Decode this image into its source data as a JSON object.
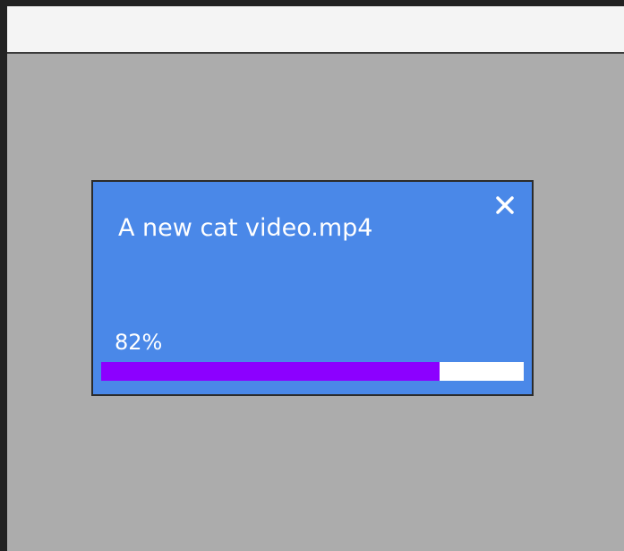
{
  "download": {
    "filename": "A new cat video.mp4",
    "progress_label": "82%",
    "progress_percent": 80,
    "close_icon": "close-icon"
  },
  "colors": {
    "dialog_background": "#4a88e8",
    "progress_fill": "#8c00ff",
    "progress_track": "#ffffff",
    "backdrop": "#acacac",
    "topbar": "#f4f4f4"
  }
}
